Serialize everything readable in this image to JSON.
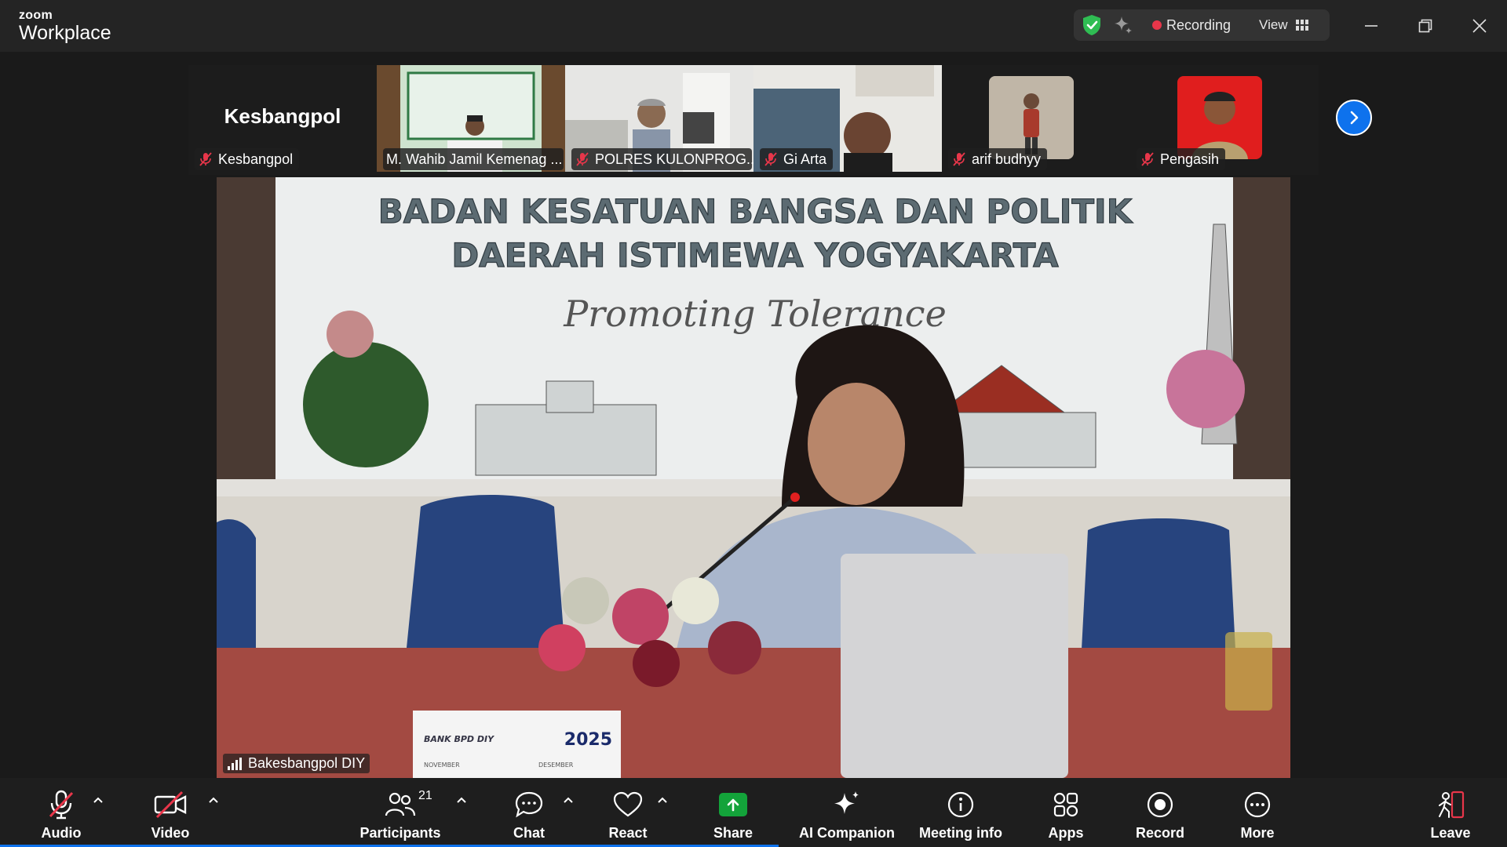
{
  "app": {
    "brand_top": "zoom",
    "brand_bottom": "Workplace"
  },
  "titlebar": {
    "recording_label": "Recording",
    "view_label": "View",
    "colors": {
      "shield": "#2fbd53",
      "record_dot": "#e8364a"
    },
    "icons": [
      "shield-check-icon",
      "sparkle-icon",
      "grid-icon",
      "minimize-icon",
      "restore-icon",
      "close-icon"
    ]
  },
  "strip": {
    "tiles": [
      {
        "title": "Kesbangpol",
        "name": "Kesbangpol"
      },
      {
        "name": "M. Wahib Jamil Kemenag ..."
      },
      {
        "name": "POLRES KULONPROG..."
      },
      {
        "name": "Gi Arta"
      },
      {
        "name": "arif budhyy"
      },
      {
        "name": "Pengasih"
      }
    ],
    "next_icon": "chevron-right-icon"
  },
  "main": {
    "banner_line1": "BADAN KESATUAN BANGSA DAN POLITIK",
    "banner_line2": "DAERAH ISTIMEWA YOGYAKARTA",
    "banner_tagline": "Promoting Tolerance",
    "calendar_brand": "BANK BPD DIY",
    "calendar_year": "2025",
    "calendar_month1": "NOVEMBER",
    "calendar_month2": "DESEMBER",
    "speaker_name": "Bakesbangpol DIY"
  },
  "toolbar": {
    "audio": "Audio",
    "video": "Video",
    "participants": "Participants",
    "participants_count": "21",
    "chat": "Chat",
    "react": "React",
    "share": "Share",
    "ai_companion": "AI Companion",
    "meeting_info": "Meeting info",
    "apps": "Apps",
    "record": "Record",
    "more": "More",
    "leave": "Leave",
    "colors": {
      "share": "#13a33a",
      "leave": "#e8364a",
      "accent": "#0e72ed"
    }
  }
}
